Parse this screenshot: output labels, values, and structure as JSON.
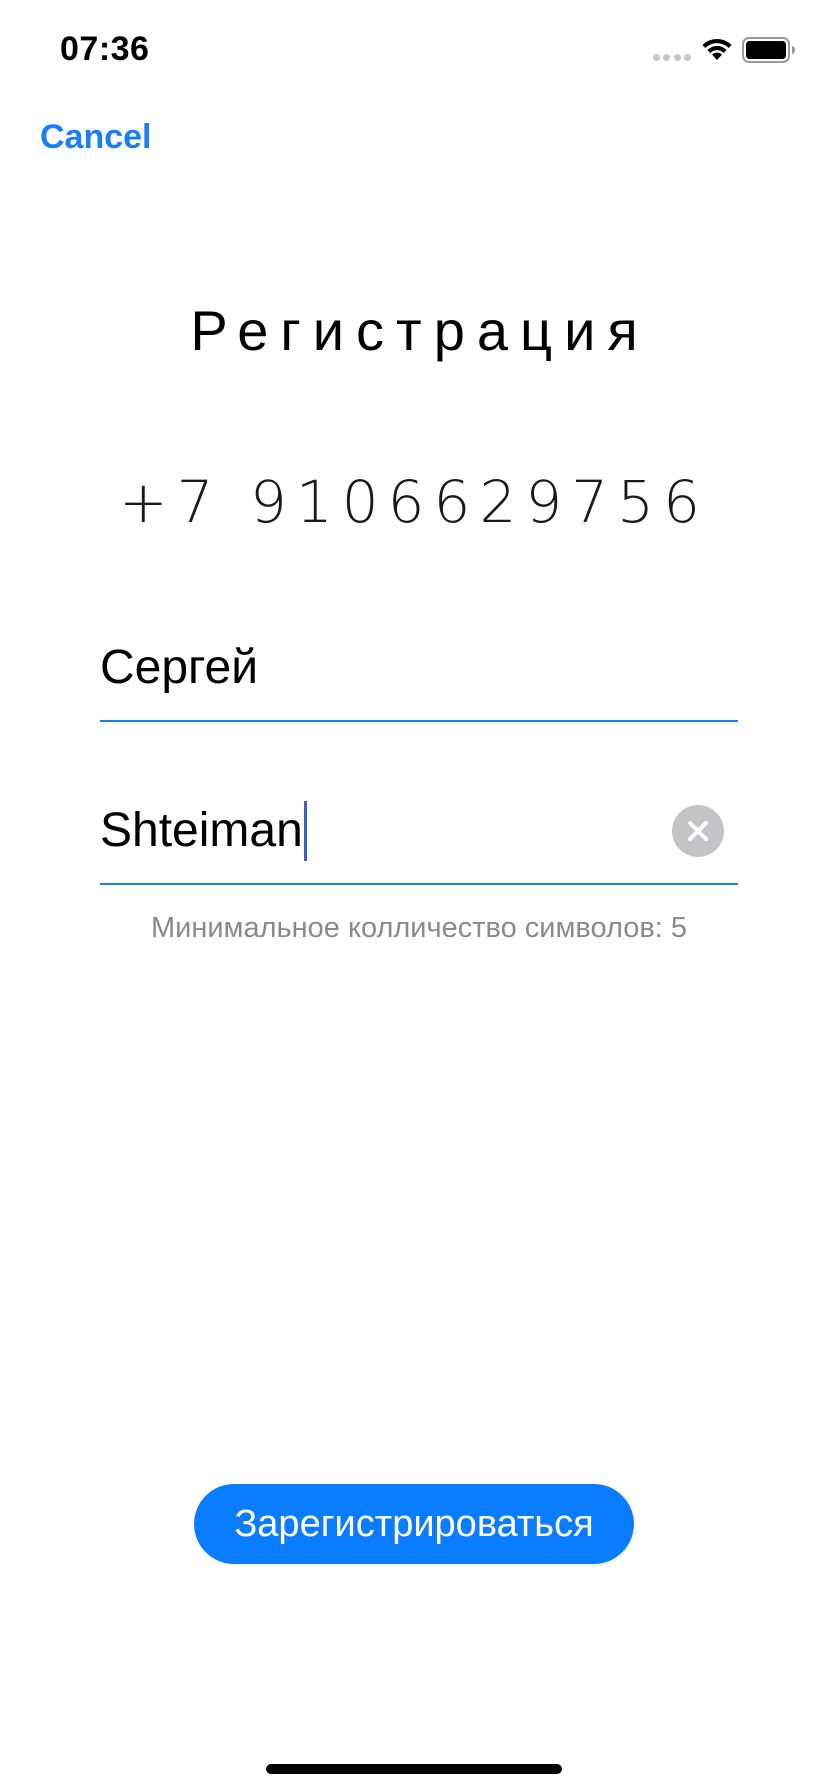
{
  "status_bar": {
    "time": "07:36",
    "icons": [
      "cellular-signal-icon",
      "wifi-icon",
      "battery-icon"
    ]
  },
  "nav": {
    "cancel_label": "Cancel"
  },
  "title": "Регистрация",
  "phone": "+7 9106629756",
  "form": {
    "first_name": "Сергей",
    "last_name": "Shteiman",
    "hint": "Минимальное колличество символов: 5"
  },
  "register_label": "Зарегистрироваться",
  "colors": {
    "accent": "#1a7ff6",
    "button": "#0a7cff",
    "hint": "#8a8a8e",
    "clear_button": "#c4c4c6"
  }
}
